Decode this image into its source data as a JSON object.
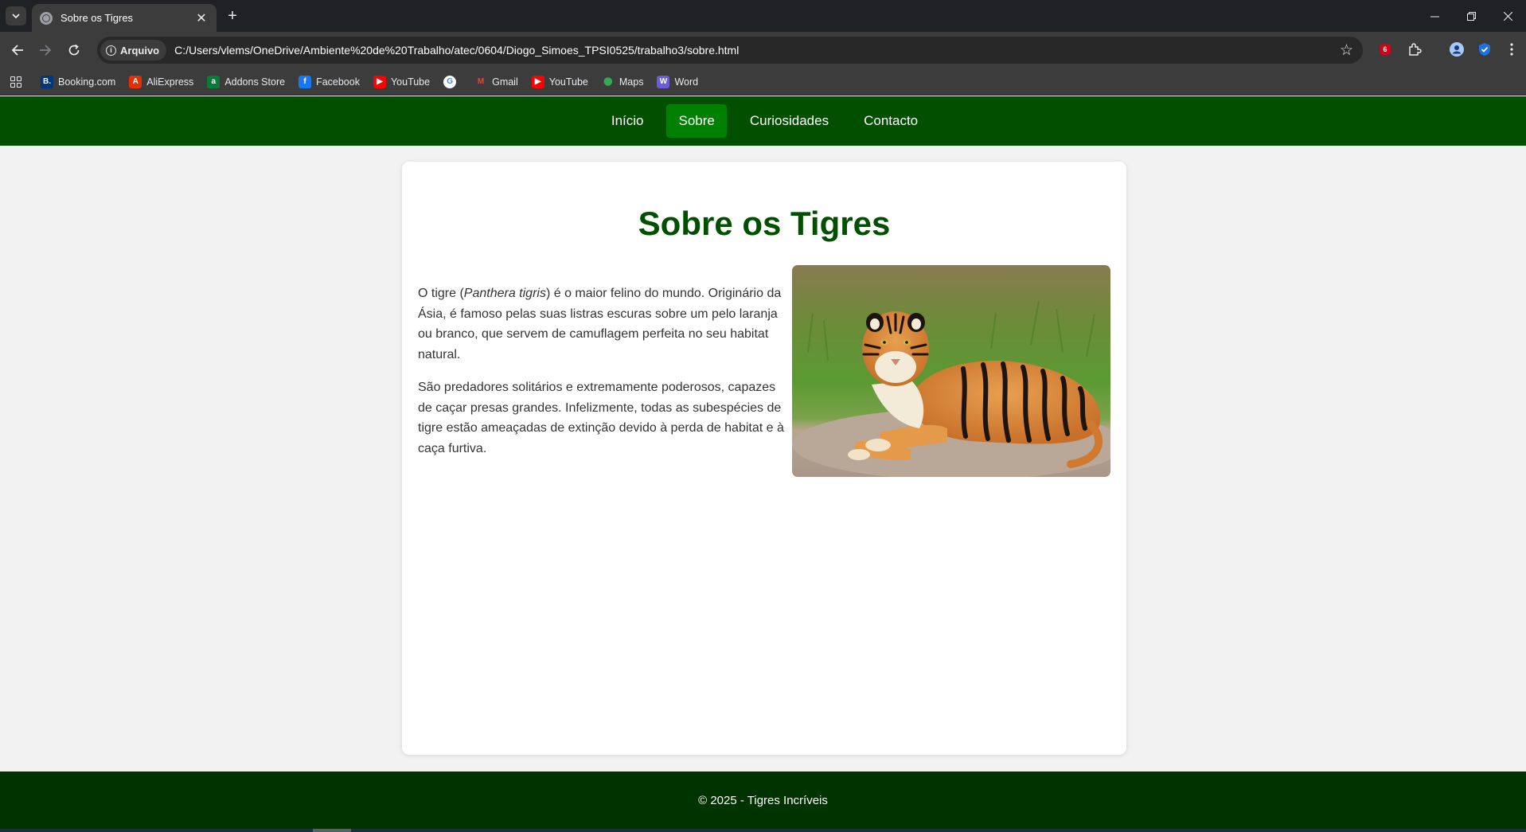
{
  "browser": {
    "tab_title": "Sobre os Tigres",
    "site_chip": "Arquivo",
    "url": "C:/Users/vlems/OneDrive/Ambiente%20de%20Trabalho/atec/0604/Diogo_Simoes_TPSI0525/trabalho3/sobre.html",
    "extension_badge": "6",
    "bookmarks": [
      {
        "label": "Booking.com",
        "icon": "booking-icon",
        "color": "#003580",
        "glyph": "B."
      },
      {
        "label": "AliExpress",
        "icon": "aliexpress-icon",
        "color": "#e62e04",
        "glyph": "A"
      },
      {
        "label": "Addons Store",
        "icon": "addons-store-icon",
        "color": "#0a7a3b",
        "glyph": "a"
      },
      {
        "label": "Facebook",
        "icon": "facebook-icon",
        "color": "#1877f2",
        "glyph": "f"
      },
      {
        "label": "YouTube",
        "icon": "youtube-icon",
        "color": "#ff0000",
        "glyph": "▶"
      },
      {
        "label": "",
        "icon": "google-icon",
        "color": "#ffffff",
        "glyph": "G"
      },
      {
        "label": "Gmail",
        "icon": "gmail-icon",
        "color": "#ea4335",
        "glyph": "M"
      },
      {
        "label": "YouTube",
        "icon": "youtube-icon",
        "color": "#ff0000",
        "glyph": "▶"
      },
      {
        "label": "Maps",
        "icon": "maps-icon",
        "color": "#34a853",
        "glyph": "⬤"
      },
      {
        "label": "Word",
        "icon": "word-icon",
        "color": "#6b5bd6",
        "glyph": "W"
      }
    ]
  },
  "nav": {
    "items": [
      "Início",
      "Sobre",
      "Curiosidades",
      "Contacto"
    ],
    "active": "Sobre",
    "active_color": "#008000",
    "bar_color": "#005000"
  },
  "main": {
    "title": "Sobre os Tigres",
    "p1_before": "O tigre (",
    "p1_italic": "Panthera tigris",
    "p1_after": ") é o maior felino do mundo. Originário da Ásia, é famoso pelas suas listras escuras sobre um pelo laranja ou branco, que servem de camuflagem perfeita no seu habitat natural.",
    "p2": "São predadores solitários e extremamente poderosos, capazes de caçar presas grandes. Infelizmente, todas as subespécies de tigre estão ameaçadas de extinção devido à perda de habitat e à caça furtiva.",
    "image": "tiger-photo"
  },
  "footer": {
    "text": "© 2025 - Tigres Incríveis",
    "color": "#003300"
  }
}
